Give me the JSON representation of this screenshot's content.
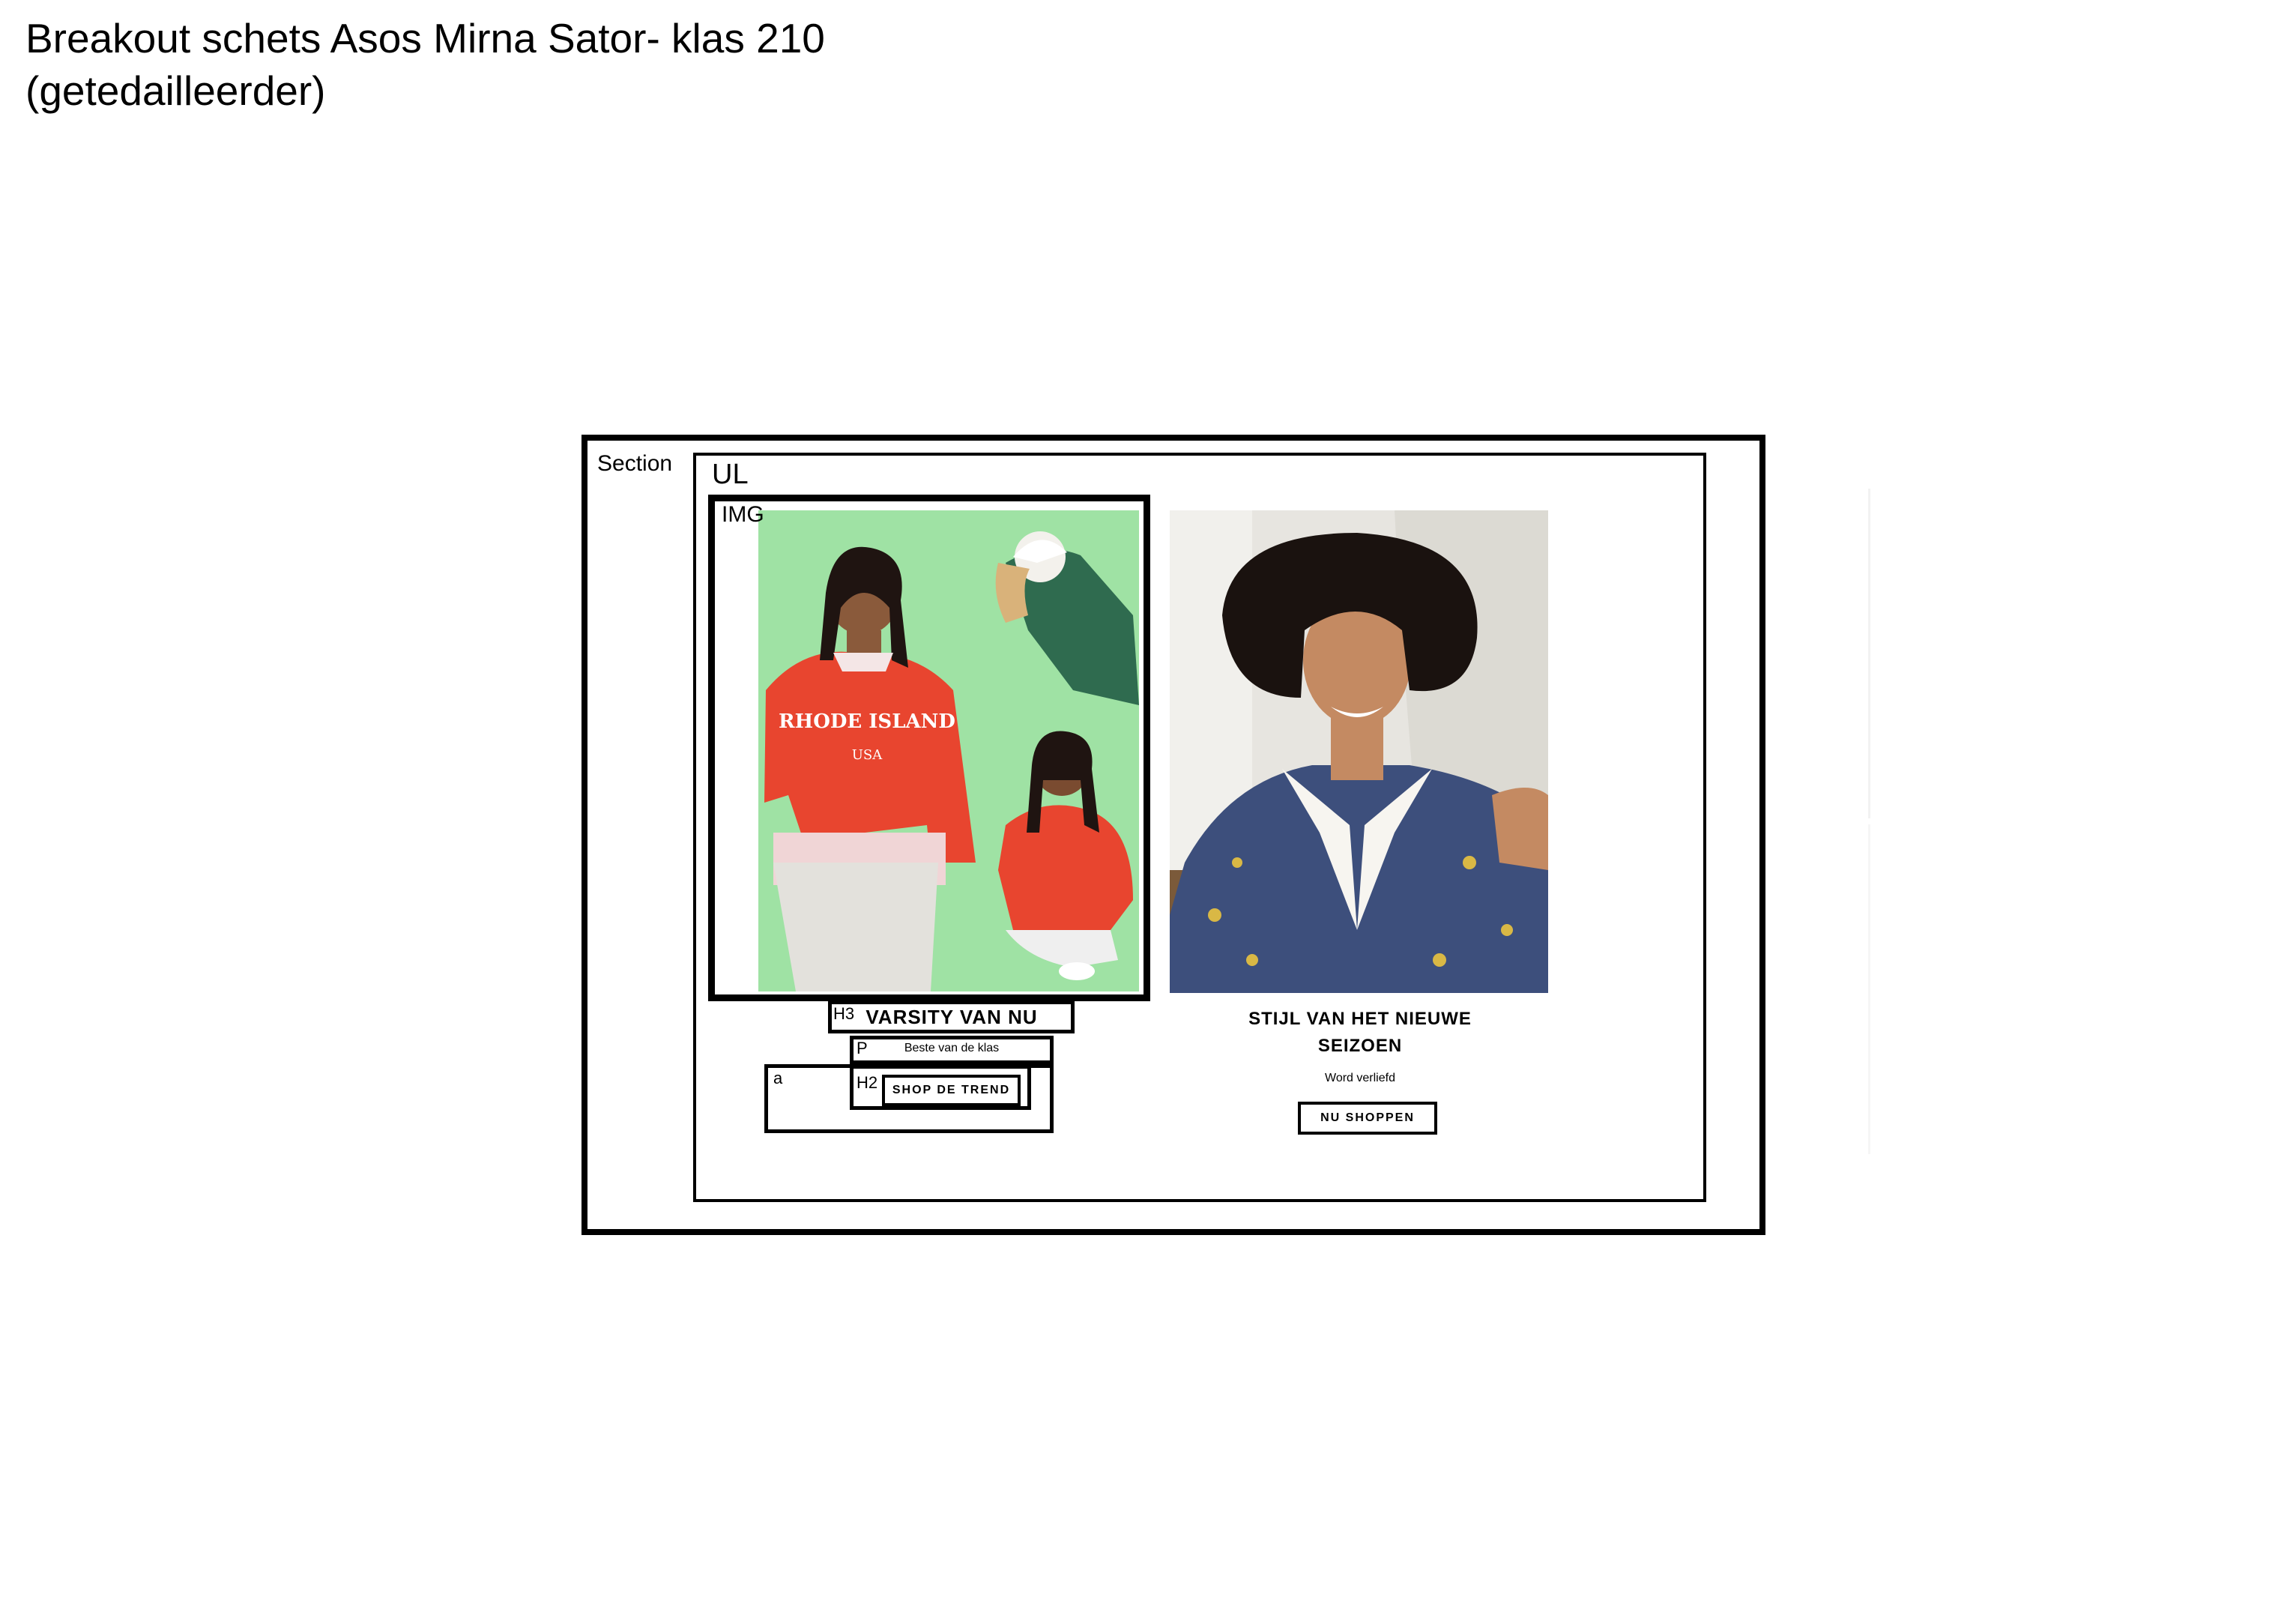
{
  "title": {
    "line1": "Breakout schets Asos  Mirna Sator- klas 210",
    "line2": "(getedailleerder)"
  },
  "labels": {
    "section": "Section",
    "ul": "UL",
    "img": "IMG",
    "h3": "H3",
    "p": "P",
    "a": "a",
    "h2": "H2"
  },
  "card1": {
    "heading": "VARSITY VAN NU",
    "subtext": "Beste van de klas",
    "button": "SHOP DE TREND",
    "sweater_text": "RHODE ISLAND",
    "sweater_sub": "USA"
  },
  "card2": {
    "heading_line1": "STIJL VAN HET NIEUWE",
    "heading_line2": "SEIZOEN",
    "subtext": "Word verliefd",
    "button": "NU SHOPPEN"
  },
  "colors": {
    "photo1_bg": "#9fe2a4",
    "sweater": "#e8452f",
    "photo2_bg": "#e7e5e0",
    "dress": "#3d4f7c"
  }
}
